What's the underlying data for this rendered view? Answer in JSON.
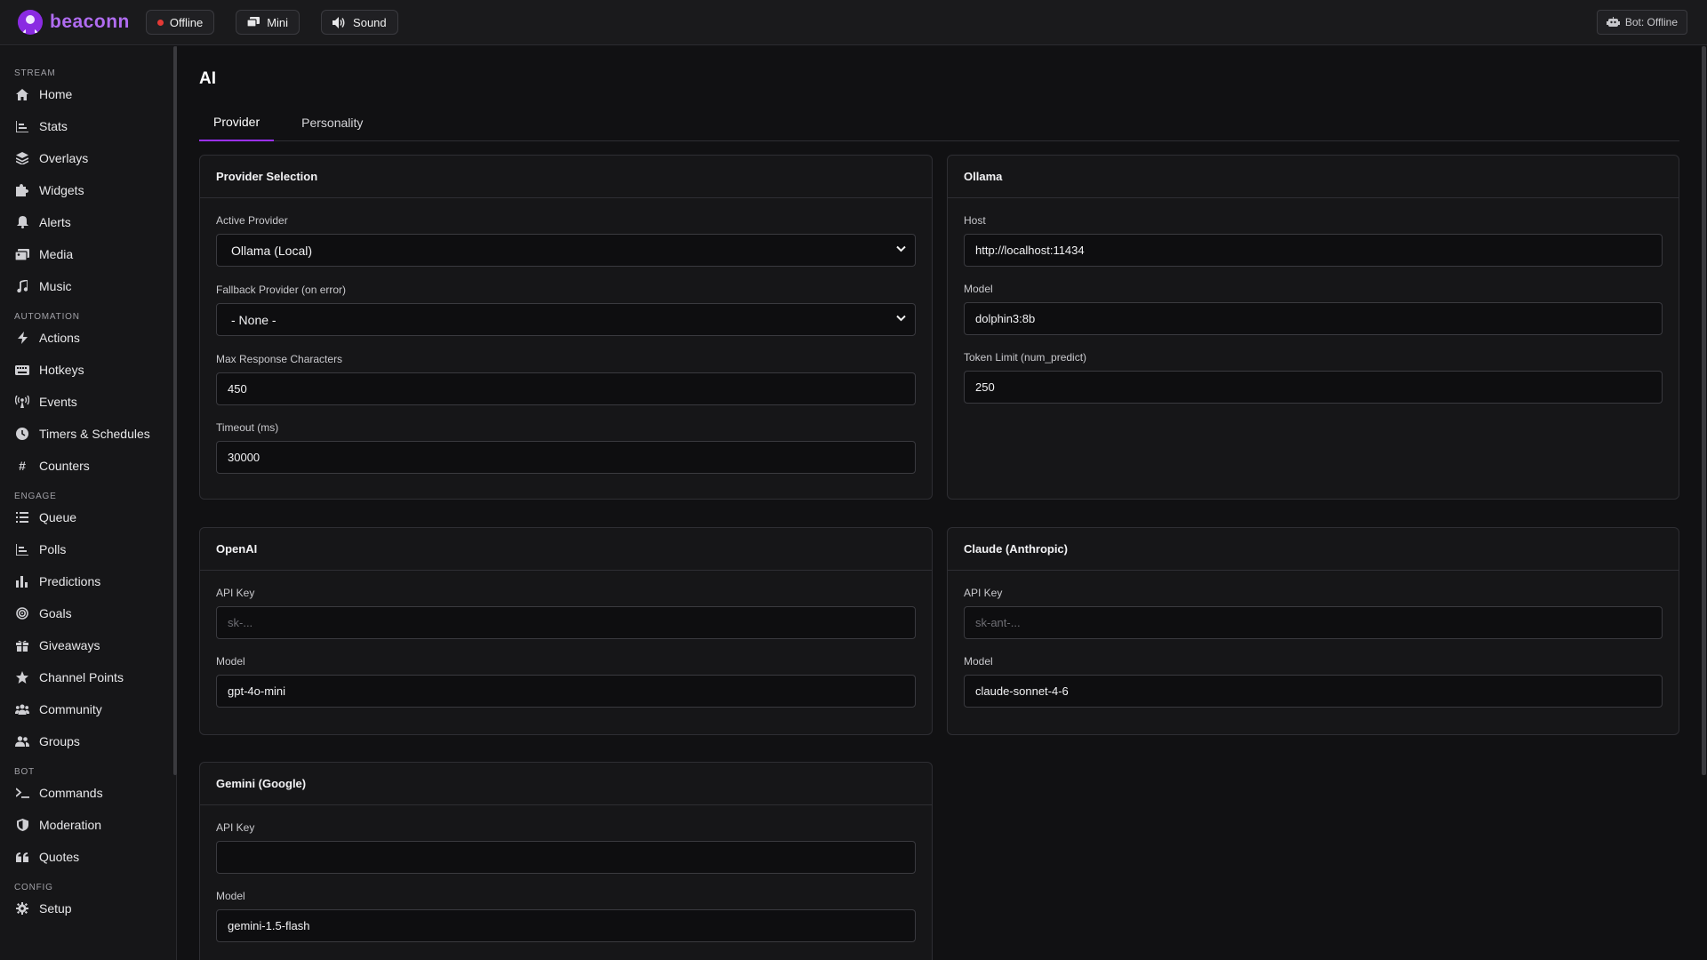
{
  "app": {
    "name": "beaconn"
  },
  "topbar": {
    "status_label": "Offline",
    "mini_label": "Mini",
    "sound_label": "Sound",
    "bot_status": "Bot: Offline"
  },
  "sidebar": {
    "sections": [
      {
        "title": "STREAM",
        "items": [
          {
            "label": "Home",
            "icon": "home-icon"
          },
          {
            "label": "Stats",
            "icon": "stats-icon"
          },
          {
            "label": "Overlays",
            "icon": "layers-icon"
          },
          {
            "label": "Widgets",
            "icon": "puzzle-icon"
          },
          {
            "label": "Alerts",
            "icon": "bell-icon"
          },
          {
            "label": "Media",
            "icon": "media-icon"
          },
          {
            "label": "Music",
            "icon": "music-icon"
          }
        ]
      },
      {
        "title": "AUTOMATION",
        "items": [
          {
            "label": "Actions",
            "icon": "bolt-icon"
          },
          {
            "label": "Hotkeys",
            "icon": "keyboard-icon"
          },
          {
            "label": "Events",
            "icon": "broadcast-icon"
          },
          {
            "label": "Timers & Schedules",
            "icon": "clock-icon"
          },
          {
            "label": "Counters",
            "icon": "hash-icon"
          }
        ]
      },
      {
        "title": "ENGAGE",
        "items": [
          {
            "label": "Queue",
            "icon": "list-icon"
          },
          {
            "label": "Polls",
            "icon": "poll-icon"
          },
          {
            "label": "Predictions",
            "icon": "bar-chart-icon"
          },
          {
            "label": "Goals",
            "icon": "target-icon"
          },
          {
            "label": "Giveaways",
            "icon": "gift-icon"
          },
          {
            "label": "Channel Points",
            "icon": "star-icon"
          },
          {
            "label": "Community",
            "icon": "community-icon"
          },
          {
            "label": "Groups",
            "icon": "users-icon"
          }
        ]
      },
      {
        "title": "BOT",
        "items": [
          {
            "label": "Commands",
            "icon": "terminal-icon"
          },
          {
            "label": "Moderation",
            "icon": "shield-icon"
          },
          {
            "label": "Quotes",
            "icon": "quote-icon"
          }
        ]
      },
      {
        "title": "CONFIG",
        "items": [
          {
            "label": "Setup",
            "icon": "gear-icon"
          }
        ]
      }
    ]
  },
  "page": {
    "title": "AI",
    "tabs": [
      {
        "label": "Provider"
      },
      {
        "label": "Personality"
      }
    ]
  },
  "cards": {
    "provider_selection": {
      "title": "Provider Selection",
      "active_provider_label": "Active Provider",
      "active_provider_value": "Ollama (Local)",
      "fallback_label": "Fallback Provider (on error)",
      "fallback_value": "- None -",
      "max_chars_label": "Max Response Characters",
      "max_chars_value": "450",
      "timeout_label": "Timeout (ms)",
      "timeout_value": "30000"
    },
    "ollama": {
      "title": "Ollama",
      "host_label": "Host",
      "host_value": "http://localhost:11434",
      "model_label": "Model",
      "model_value": "dolphin3:8b",
      "token_label": "Token Limit (num_predict)",
      "token_value": "250"
    },
    "openai": {
      "title": "OpenAI",
      "api_key_label": "API Key",
      "api_key_placeholder": "sk-...",
      "model_label": "Model",
      "model_value": "gpt-4o-mini"
    },
    "claude": {
      "title": "Claude (Anthropic)",
      "api_key_label": "API Key",
      "api_key_placeholder": "sk-ant-...",
      "model_label": "Model",
      "model_value": "claude-sonnet-4-6"
    },
    "gemini": {
      "title": "Gemini (Google)",
      "api_key_label": "API Key",
      "api_key_value": "",
      "model_label": "Model",
      "model_value": "gemini-1.5-flash"
    }
  },
  "colors": {
    "accent": "#9b30ff",
    "brand": "#b06cf0",
    "offline_dot": "#e53935",
    "background": "#111113"
  }
}
